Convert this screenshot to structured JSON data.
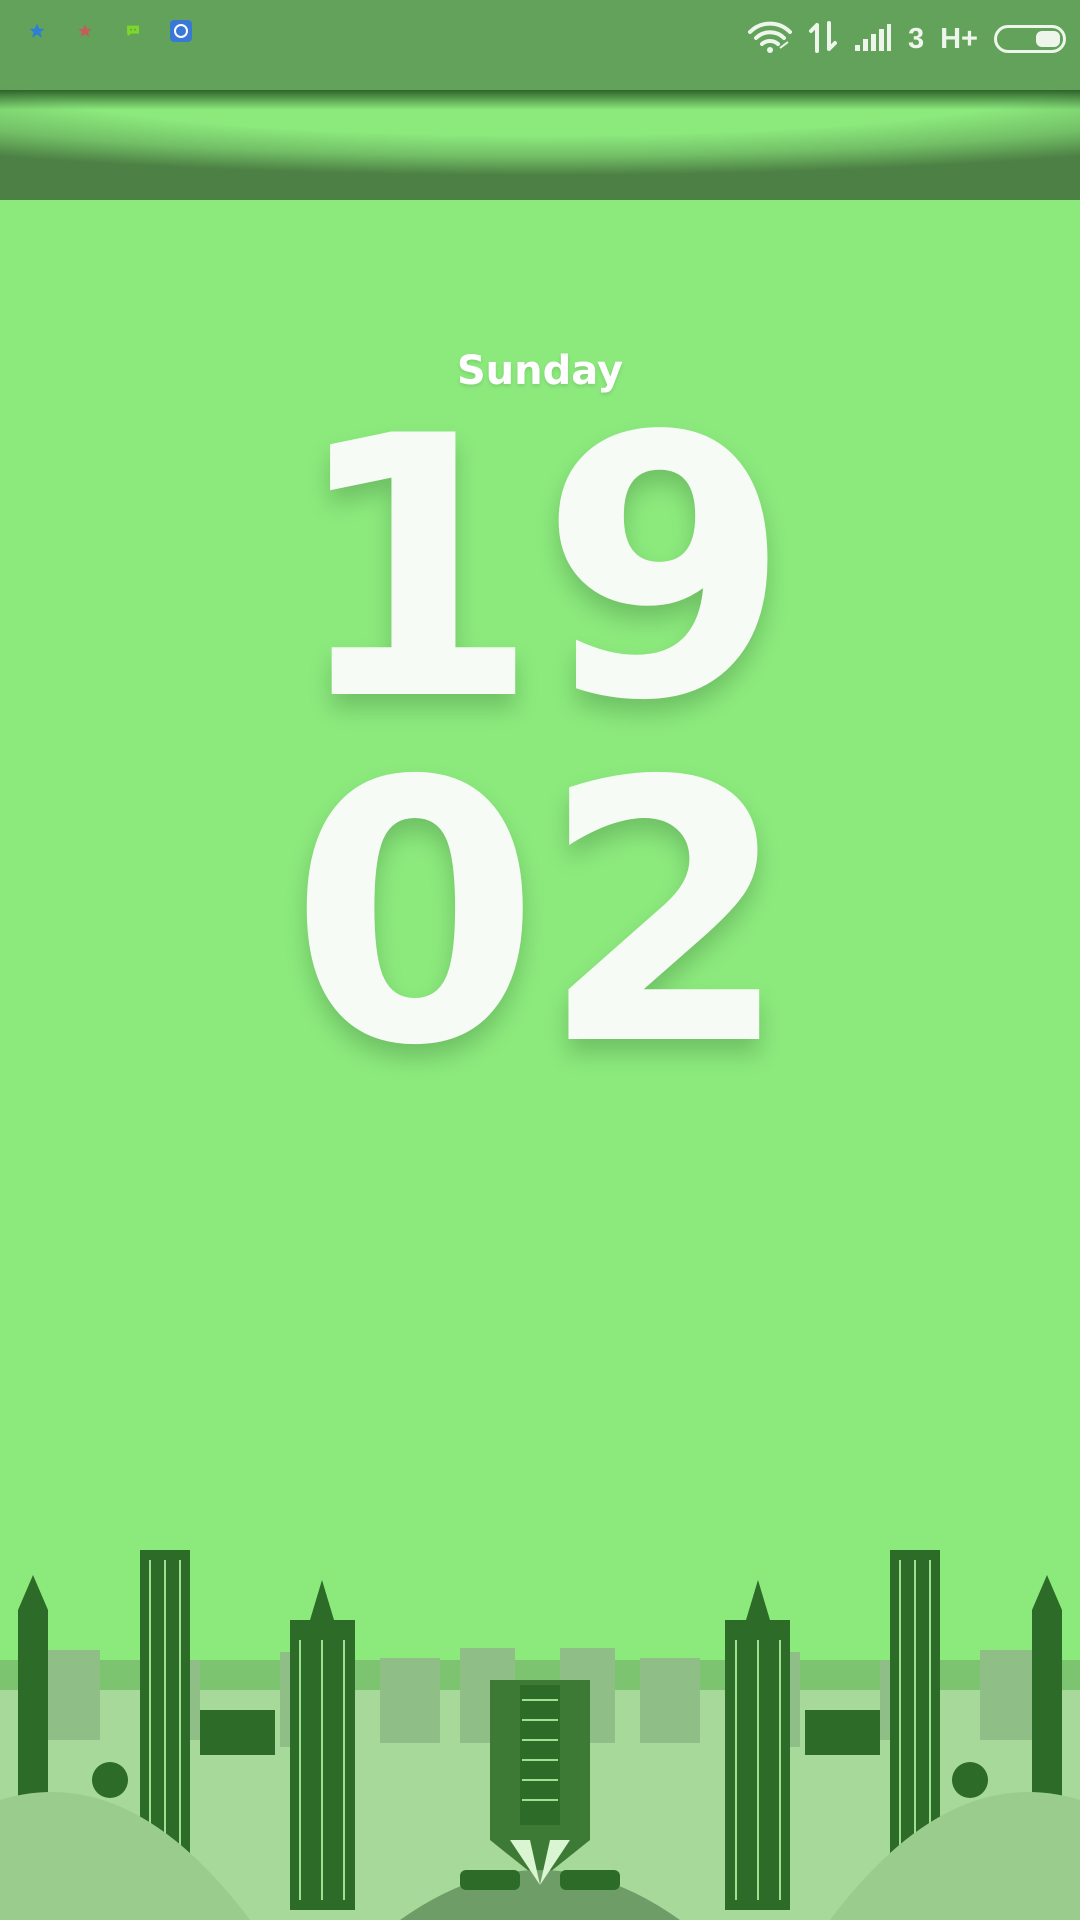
{
  "status_bar": {
    "notifications": [
      {
        "icon": "star-icon",
        "color": "#2a7fd6"
      },
      {
        "icon": "star-icon",
        "color": "#c85a5a"
      },
      {
        "icon": "chat-bubble-icon",
        "color": "#7dd62a"
      },
      {
        "icon": "app-icon",
        "color": "#3a78d8"
      }
    ],
    "network_label": "3",
    "network_type": "H+"
  },
  "lockscreen": {
    "day": "Sunday",
    "hours": "19",
    "minutes": "02"
  },
  "colors": {
    "background": "#8cea7d",
    "status_bar": "#63a25a",
    "clock_text": "#f6fbf5",
    "city_dark": "#2d6b28",
    "city_mid": "#5c9a55",
    "city_light": "#b3f0a4"
  }
}
